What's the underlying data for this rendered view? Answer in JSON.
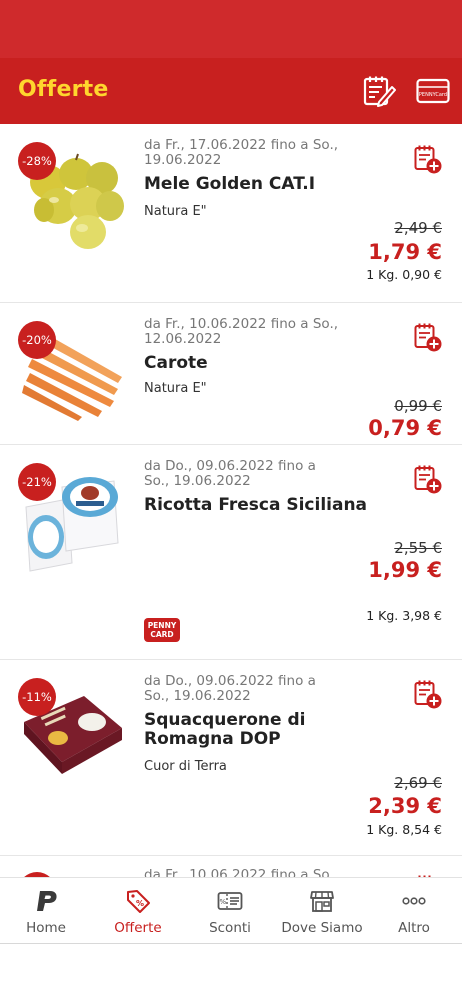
{
  "header": {
    "title": "Offerte",
    "shopping_list_icon": "shopping-list-edit-icon",
    "card_icon": "penny-card-icon",
    "card_icon_text": "PENNYCard"
  },
  "offers": [
    {
      "discount": "-28%",
      "dates": "da Fr., 17.06.2022 fino a So., 19.06.2022",
      "name": "Mele Golden CAT.I",
      "brand": "Natura E\"",
      "old_price": "2,49 €",
      "price": "1,79 €",
      "unit_price": "1 Kg. 0,90 €"
    },
    {
      "discount": "-20%",
      "dates": "da Fr., 10.06.2022 fino a So., 12.06.2022",
      "name": "Carote",
      "brand": "Natura E\"",
      "old_price": "0,99 €",
      "price": "0,79 €",
      "unit_price": ""
    },
    {
      "discount": "-21%",
      "dates": "da Do., 09.06.2022 fino a So., 19.06.2022",
      "name": "Ricotta Fresca Siciliana",
      "brand": "",
      "old_price": "2,55 €",
      "price": "1,99 €",
      "unit_price": "1 Kg. 3,98 €",
      "penny_card_label": "PENNY CARD"
    },
    {
      "discount": "-11%",
      "dates": "da Do., 09.06.2022 fino a So., 19.06.2022",
      "name": "Squacquerone di Romagna DOP",
      "brand": "Cuor di Terra",
      "old_price": "2,69 €",
      "price": "2,39 €",
      "unit_price": "1 Kg. 8,54 €"
    },
    {
      "discount": "",
      "dates": "da Fr., 10.06.2022 fino a So.",
      "name": "",
      "brand": "",
      "old_price": "",
      "price": "",
      "unit_price": ""
    }
  ],
  "nav": {
    "items": [
      {
        "label": "Home",
        "icon": "penny-logo-icon"
      },
      {
        "label": "Offerte",
        "icon": "price-tag-percent-icon",
        "active": true
      },
      {
        "label": "Sconti",
        "icon": "coupon-icon"
      },
      {
        "label": "Dove Siamo",
        "icon": "store-icon"
      },
      {
        "label": "Altro",
        "icon": "more-dots-icon"
      }
    ]
  },
  "colors": {
    "brand_red": "#c8201f",
    "title_yellow": "#ffd62e"
  }
}
